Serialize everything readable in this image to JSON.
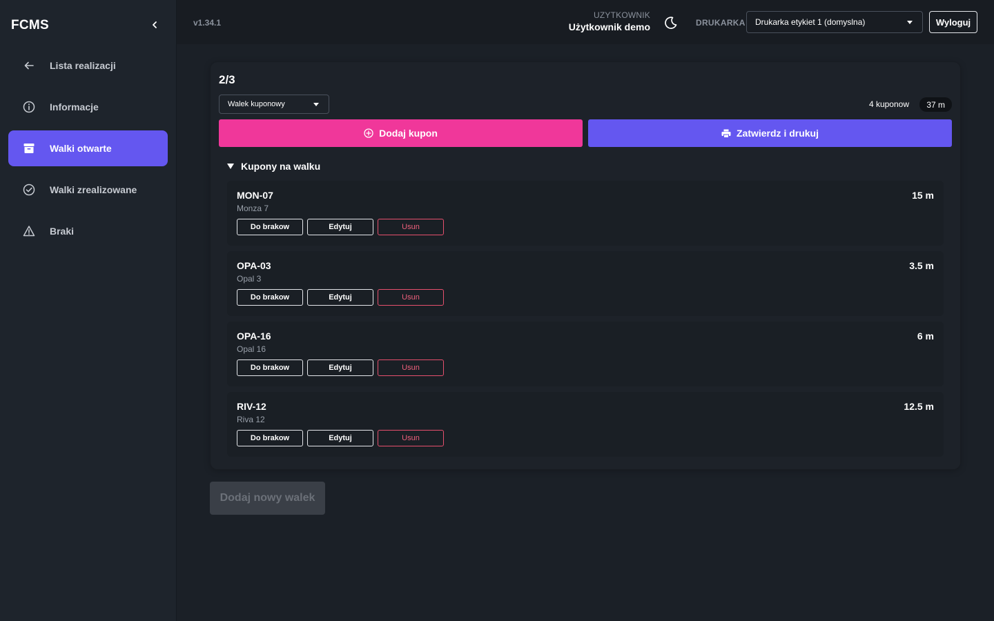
{
  "sidebar": {
    "brand": "FCMS",
    "items": [
      {
        "label": "Lista realizacji",
        "icon": "arrow-left-icon",
        "active": false
      },
      {
        "label": "Informacje",
        "icon": "info-circle-icon",
        "active": false
      },
      {
        "label": "Walki otwarte",
        "icon": "archive-box-icon",
        "active": true
      },
      {
        "label": "Walki zrealizowane",
        "icon": "check-circle-icon",
        "active": false
      },
      {
        "label": "Braki",
        "icon": "warning-triangle-icon",
        "active": false
      }
    ]
  },
  "topbar": {
    "version": "v1.34.1",
    "user_caption": "UZYTKOWNIK",
    "user_name": "Użytkownik demo",
    "printer_caption": "DRUKARKA",
    "printer_value": "Drukarka etykiet 1 (domyslna)",
    "logout_label": "Wyloguj"
  },
  "main": {
    "step": "2/3",
    "roll_type": "Walek kuponowy",
    "coupon_count": "4 kuponow",
    "total_length": "37 m",
    "add_coupon_label": "Dodaj kupon",
    "confirm_label": "Zatwierdz i drukuj",
    "section_title": "Kupony na walku",
    "action_labels": {
      "scrap": "Do brakow",
      "edit": "Edytuj",
      "remove": "Usun"
    },
    "coupons": [
      {
        "code": "MON-07",
        "name": "Monza 7",
        "length": "15 m"
      },
      {
        "code": "OPA-03",
        "name": "Opal 3",
        "length": "3.5 m"
      },
      {
        "code": "OPA-16",
        "name": "Opal 16",
        "length": "6 m"
      },
      {
        "code": "RIV-12",
        "name": "Riva 12",
        "length": "12.5 m"
      }
    ],
    "new_roll_label": "Dodaj nowy walek"
  },
  "colors": {
    "accent": "#6457f0",
    "pink": "#f0379a",
    "danger": "#e8506e",
    "background": "#1b2027"
  }
}
